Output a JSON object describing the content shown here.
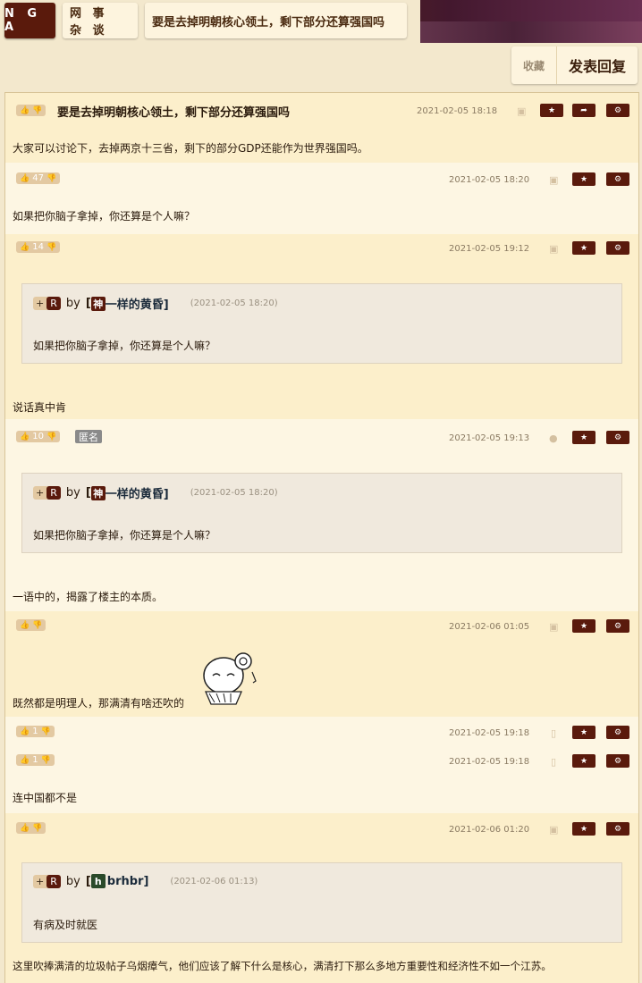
{
  "header": {
    "logo": "N G A",
    "board": "网 事 杂 谈",
    "thread_title": "要是去掉明朝核心领土，剩下部分还算强国吗"
  },
  "actions": {
    "favorite": "收藏",
    "reply": "发表回复"
  },
  "posts": [
    {
      "votes": "",
      "title": "要是去掉明朝核心领土，剩下部分还算强国吗",
      "date": "2021-02-05 18:18",
      "device": "android",
      "text": "大家可以讨论下，去掉两京十三省，剩下的部分GDP还能作为世界强国吗。"
    },
    {
      "votes": "47",
      "date": "2021-02-05 18:20",
      "device": "android",
      "text": "如果把你脑子拿掉，你还算是个人嘛？"
    },
    {
      "votes": "14",
      "date": "2021-02-05 19:12",
      "device": "android",
      "quote": {
        "user_avatar": "神",
        "user": "一样的黄昏]",
        "date": "(2021-02-05 18:20)",
        "text": "如果把你脑子拿掉，你还算是个人嘛？"
      },
      "text": "说话真中肯"
    },
    {
      "votes": "10",
      "badge": "匿名",
      "date": "2021-02-05 19:13",
      "device": "apple",
      "quote": {
        "user_avatar": "神",
        "user": "一样的黄昏]",
        "date": "(2021-02-05 18:20)",
        "text": "如果把你脑子拿掉，你还算是个人嘛？"
      },
      "text": "一语中的，揭露了楼主的本质。"
    },
    {
      "votes": "",
      "date": "2021-02-06 01:05",
      "device": "android",
      "text": "既然都是明理人，那满清有啥还吹的"
    },
    {
      "votes": "1",
      "date": "2021-02-05 19:18",
      "device": "phone"
    },
    {
      "votes": "1",
      "date": "2021-02-05 19:18",
      "device": "phone",
      "text": "连中国都不是"
    },
    {
      "votes": "",
      "date": "2021-02-06 01:20",
      "device": "android",
      "quote": {
        "user_avatar": "h",
        "user": "brhbr]",
        "date": "(2021-02-06 01:13)",
        "text": "有病及时就医"
      },
      "text": "这里吹捧满清的垃圾帖子乌烟瘴气，他们应该了解下什么是核心，满清打下那么多地方重要性和经济性不如一个江苏。"
    }
  ],
  "quote_labels": {
    "plus": "+",
    "reply_tag": "R",
    "by": "by",
    "bracket": "["
  },
  "icons": {
    "like": "thumb-up-icon",
    "dislike": "thumb-down-icon",
    "star": "star-icon",
    "share": "share-icon",
    "settings": "gear-icon"
  },
  "colors": {
    "accent": "#5a1a0c",
    "vote_bg": "#e3c9a2",
    "post_dark": "#fcefcb",
    "post_light": "#fdf6e3"
  }
}
